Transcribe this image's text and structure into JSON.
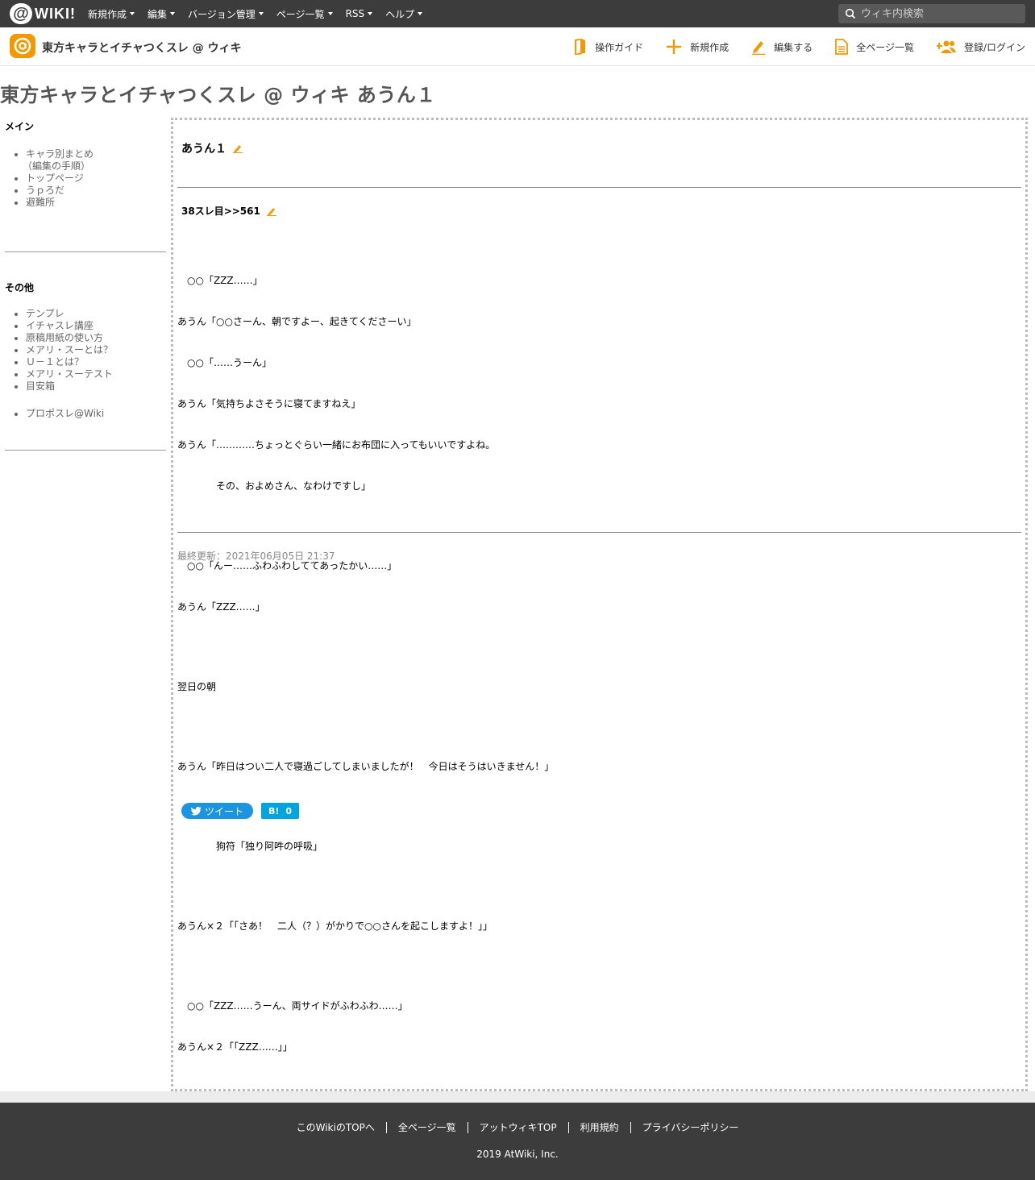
{
  "topbar": {
    "logo_at": "@",
    "logo_text": "WIKI!",
    "menu": [
      {
        "label": "新規作成"
      },
      {
        "label": "編集"
      },
      {
        "label": "バージョン管理"
      },
      {
        "label": "ページ一覧"
      },
      {
        "label": "RSS"
      },
      {
        "label": "ヘルプ"
      }
    ],
    "search_placeholder": "ウィキ内検索"
  },
  "header": {
    "wiki_title": "東方キャラとイチャつくスレ @ ウィキ",
    "nav": [
      {
        "label": "操作ガイド",
        "icon": "book-icon"
      },
      {
        "label": "新規作成",
        "icon": "plus-icon"
      },
      {
        "label": "編集する",
        "icon": "pencil-icon"
      },
      {
        "label": "全ページ一覧",
        "icon": "document-icon"
      },
      {
        "label": "登録/ログイン",
        "icon": "add-user-icon"
      }
    ],
    "accent_color": "#f39800"
  },
  "page_title": "東方キャラとイチャつくスレ @ ウィキ あうん１",
  "sidebar": {
    "main_heading": "メイン",
    "main_items": [
      "キャラ別まとめ",
      "トップページ",
      "うｐろだ",
      "避難所"
    ],
    "main_item_note": "（編集の手順）",
    "other_heading": "その他",
    "other_items": [
      "テンプレ",
      "イチャスレ講座",
      "原稿用紙の使い方",
      "メアリ・スーとは？",
      "Ｕ－１とは？",
      "メアリ・スーテスト",
      "目安箱"
    ],
    "extra_items": [
      "プロポスレ@Wiki"
    ]
  },
  "main": {
    "heading": "あうん１",
    "subheading": "38スレ目>>561",
    "lines": [
      "　○○「ZZZ……」",
      "あうん「○○さーん、朝ですよー、起きてくださーい」",
      "　○○「……うーん」",
      "あうん「気持ちよさそうに寝てますねえ」",
      "あうん「…………ちょっとぐらい一緒にお布団に入ってもいいですよね。",
      "　　　　その、およめさん、なわけですし」",
      "",
      "　○○「んー……ふわふわしててあったかい……」",
      "あうん「ZZZ……」",
      "",
      "翌日の朝",
      "",
      "あうん「昨日はつい二人で寝過ごしてしまいましたが！　今日はそうはいきません！」",
      "",
      "　　　　狗符「独り阿吽の呼吸」",
      "",
      "あうん×２「「さあ！　二人（？）がかりで○○さんを起こしますよ！」」",
      "",
      "　○○「ZZZ……うーん、両サイドがふわふわ……」",
      "あうん×２「「ZZZ……」」"
    ],
    "last_updated": "最終更新：2021年06月05日 21:37",
    "tweet_label": "ツイート",
    "hatena_label": "B!",
    "hatena_count": "0"
  },
  "footer": {
    "links": [
      "このWikiのTOPへ",
      "全ページ一覧",
      "アットウィキTOP",
      "利用規約",
      "プライバシーポリシー"
    ],
    "copyright": "2019 AtWiki, Inc."
  }
}
